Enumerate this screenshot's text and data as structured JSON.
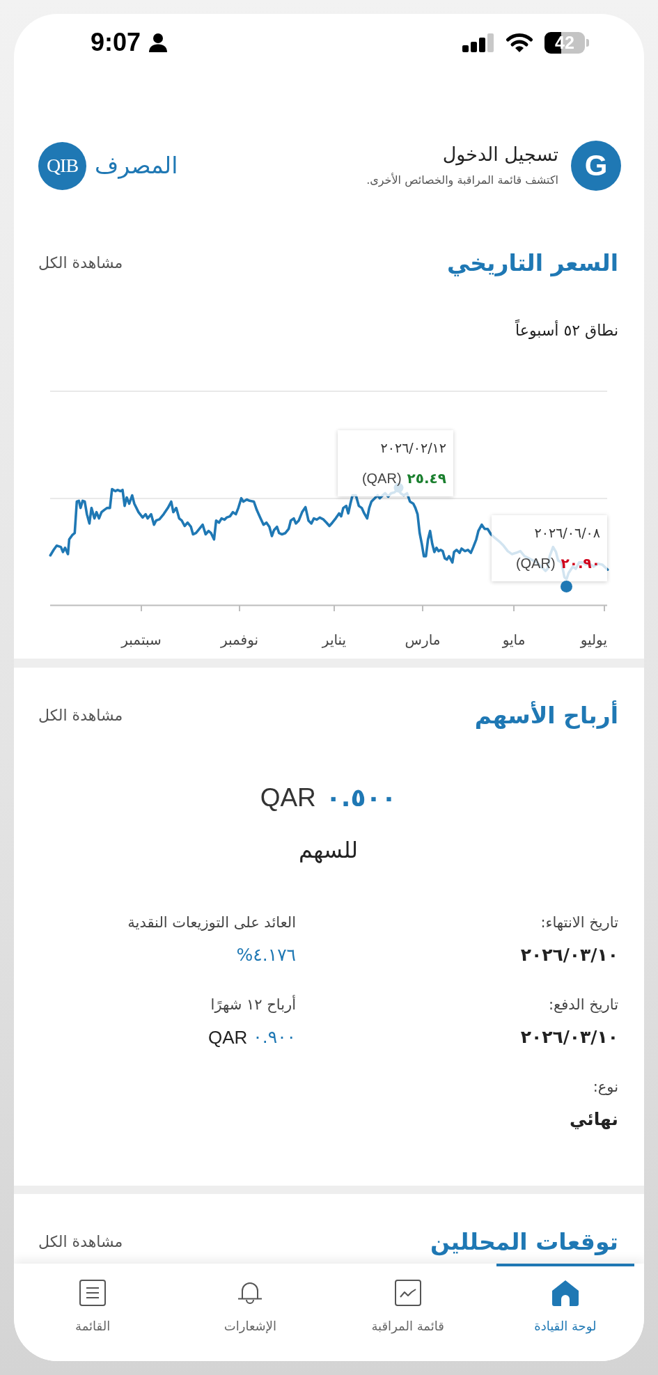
{
  "status_bar": {
    "time": "9:07",
    "battery": "42"
  },
  "header": {
    "avatar": "G",
    "title": "تسجيل الدخول",
    "subtitle": "اكتشف قائمة المراقبة والخصائص الأخرى.",
    "logo": {
      "mark": "QIB",
      "name": "المصرف"
    }
  },
  "price_history": {
    "title": "السعر التاريخي",
    "link": "مشاهدة الكل",
    "range_label": "نطاق ٥٢ أسبوعاً",
    "x_labels": [
      "يوليو",
      "مايو",
      "مارس",
      "يناير",
      "نوفمبر",
      "سبتمبر"
    ],
    "tooltips": [
      {
        "date": "٢٠٢٦/٠٢/١٢",
        "value": "٢٥.٤٩",
        "currency": "(QAR)",
        "color": "#1a7f2e"
      },
      {
        "date": "٢٠٢٦/٠٦/٠٨",
        "value": "٢٠.٩٠",
        "currency": "(QAR)",
        "color": "#d0021b"
      }
    ]
  },
  "dividends": {
    "title": "أرباح الأسهم",
    "link": "مشاهدة الكل",
    "amount": {
      "value": "٠.٥٠٠",
      "currency": "QAR"
    },
    "per_share": "للسهم",
    "details": [
      {
        "label": "تاريخ الانتهاء:",
        "value": "٢٠٢٦/٠٣/١٠",
        "kind": "plain"
      },
      {
        "label": "العائد على التوزيعات النقدية",
        "value": "٤.١٧٦%",
        "kind": "accent"
      },
      {
        "label": "تاريخ الدفع:",
        "value": "٢٠٢٦/٠٣/١٠",
        "kind": "plain"
      },
      {
        "label": "أرباح ١٢ شهرًا",
        "value": "٠.٩٠٠",
        "currency": "QAR",
        "kind": "accent"
      },
      {
        "label": "نوع:",
        "value": "نهائي",
        "kind": "plain"
      }
    ]
  },
  "analyst_forecasts": {
    "title": "توقعات المحللين",
    "link": "مشاهدة الكل"
  },
  "nav": [
    {
      "label": "لوحة القيادة",
      "kind": "dashboard",
      "selected": true
    },
    {
      "label": "قائمة المراقبة",
      "kind": "watchlist",
      "selected": false
    },
    {
      "label": "الإشعارات",
      "kind": "notifications",
      "selected": false
    },
    {
      "label": "القائمة",
      "kind": "menu",
      "selected": false
    }
  ]
}
